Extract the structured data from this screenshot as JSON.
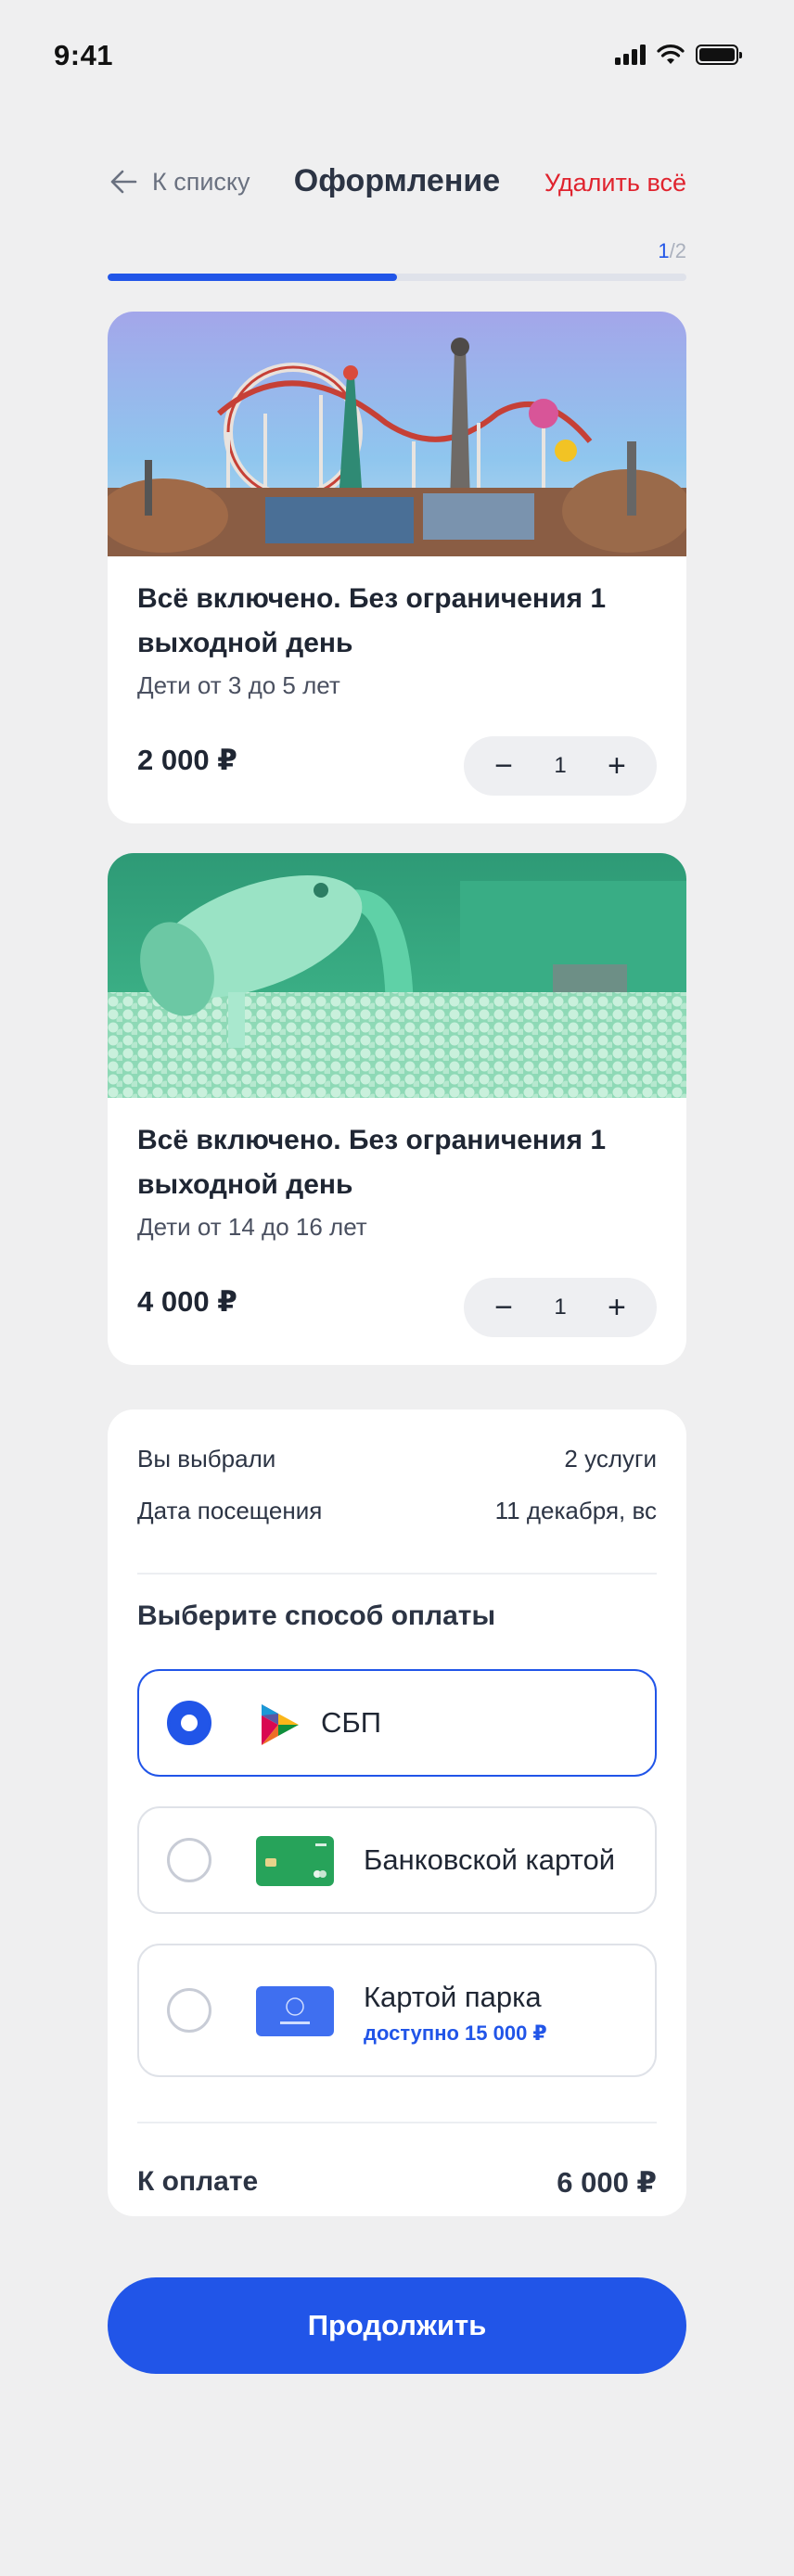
{
  "status_bar": {
    "time": "9:41",
    "icons": [
      "signal-icon",
      "wifi-icon",
      "battery-icon"
    ]
  },
  "header": {
    "back_label": "К списку",
    "title": "Оформление",
    "delete_all": "Удалить всё"
  },
  "progress": {
    "current": "1",
    "separator": "/",
    "total": "2",
    "fraction": 0.5
  },
  "cart": [
    {
      "image": "amusement-park-photo",
      "title": "Всё включено. Без ограничения 1 выходной день",
      "subtitle": "Дети от 3 до 5 лет",
      "price": "2 000 ₽",
      "quantity": "1",
      "minus": "−",
      "plus": "+"
    },
    {
      "image": "ball-pit-photo",
      "title": "Всё включено. Без ограничения 1 выходной день",
      "subtitle": "Дети от 14 до 16 лет",
      "price": "4 000 ₽",
      "quantity": "1",
      "minus": "−",
      "plus": "+"
    }
  ],
  "summary": {
    "selected_label": "Вы выбрали",
    "selected_value": "2 услуги",
    "date_label": "Дата посещения",
    "date_value": "11 декабря, вс",
    "payment_title": "Выберите способ оплаты",
    "payment_methods": [
      {
        "label": "СБП",
        "icon": "sbp-logo-icon",
        "selected": true
      },
      {
        "label": "Банковской картой",
        "icon": "bank-card-icon",
        "selected": false
      },
      {
        "label": "Картой парка",
        "note": "доступно 15 000 ₽",
        "icon": "park-card-icon",
        "selected": false
      }
    ],
    "total_label": "К оплате",
    "total_value": "6 000 ₽"
  },
  "continue_label": "Продолжить",
  "colors": {
    "accent": "#2155e8",
    "danger": "#e0232e",
    "background": "#efeff0"
  }
}
